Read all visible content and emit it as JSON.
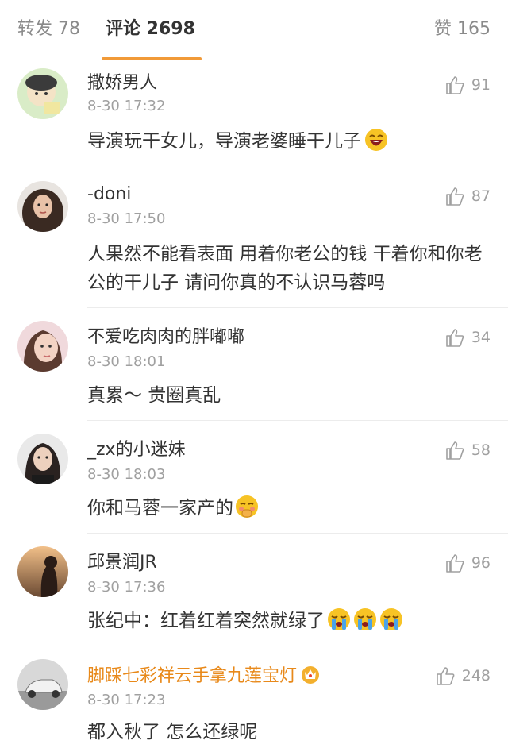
{
  "tabs": {
    "repost": "转发 78",
    "comment": "评论 2698",
    "like": "赞 165"
  },
  "comments": [
    {
      "user": "撒娇男人",
      "time": "8-30 17:32",
      "likes": "91",
      "text": "导演玩干女儿，导演老婆睡干儿子"
    },
    {
      "user": "-doni",
      "time": "8-30 17:50",
      "likes": "87",
      "text": "人果然不能看表面 用着你老公的钱 干着你和你老公的干儿子  请问你真的不认识马蓉吗"
    },
    {
      "user": "不爱吃肉肉的胖嘟嘟",
      "time": "8-30 18:01",
      "likes": "34",
      "text": "真累～  贵圈真乱"
    },
    {
      "user": "_zx的小迷妹",
      "time": "8-30 18:03",
      "likes": "58",
      "text": "你和马蓉一家产的"
    },
    {
      "user": "邱景润JR",
      "time": "8-30 17:36",
      "likes": "96",
      "text": "张纪中：红着红着突然就绿了"
    },
    {
      "user": "脚踩七彩祥云手拿九莲宝灯",
      "time": "8-30 17:23",
      "likes": "248",
      "text": "都入秋了 怎么还绿呢"
    }
  ],
  "colors": {
    "accent": "#f19a38",
    "vip_name": "#e8891a",
    "meta": "#a0a0a0"
  }
}
